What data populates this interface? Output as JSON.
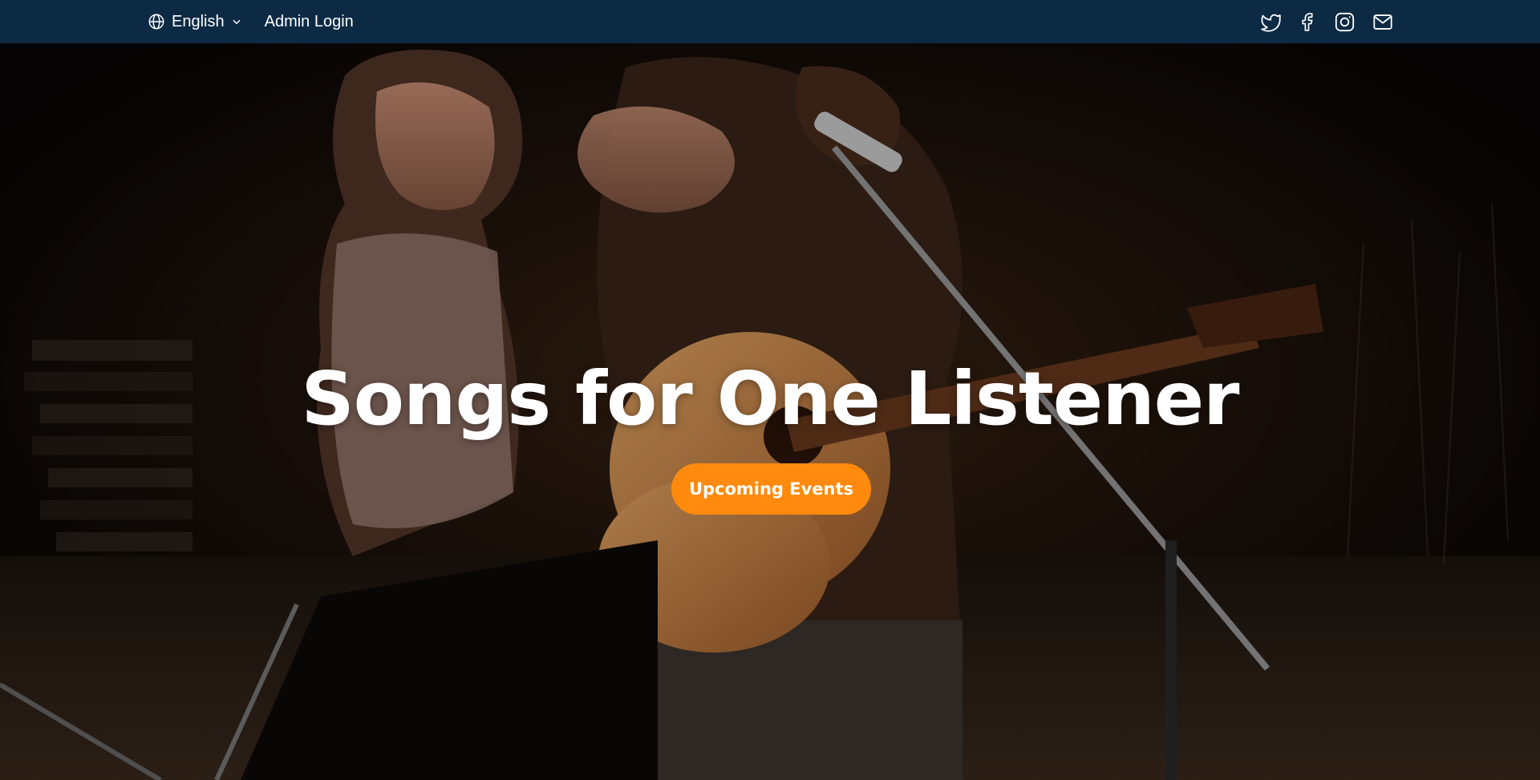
{
  "topbar": {
    "language": {
      "label": "English",
      "icon": "globe-icon",
      "caret": "chevron-down-icon"
    },
    "admin_login": "Admin Login",
    "social": [
      {
        "name": "twitter",
        "icon": "twitter-icon"
      },
      {
        "name": "facebook",
        "icon": "facebook-icon"
      },
      {
        "name": "instagram",
        "icon": "instagram-icon"
      },
      {
        "name": "email",
        "icon": "mail-icon"
      }
    ]
  },
  "hero": {
    "title": "Songs for One Listener",
    "cta_label": "Upcoming Events",
    "background": "photo of two musicians performing outdoors at night with acoustic guitar and microphone stand"
  },
  "colors": {
    "topbar_bg": "#0d2a44",
    "accent": "#ff8a0d",
    "text": "#ffffff"
  }
}
